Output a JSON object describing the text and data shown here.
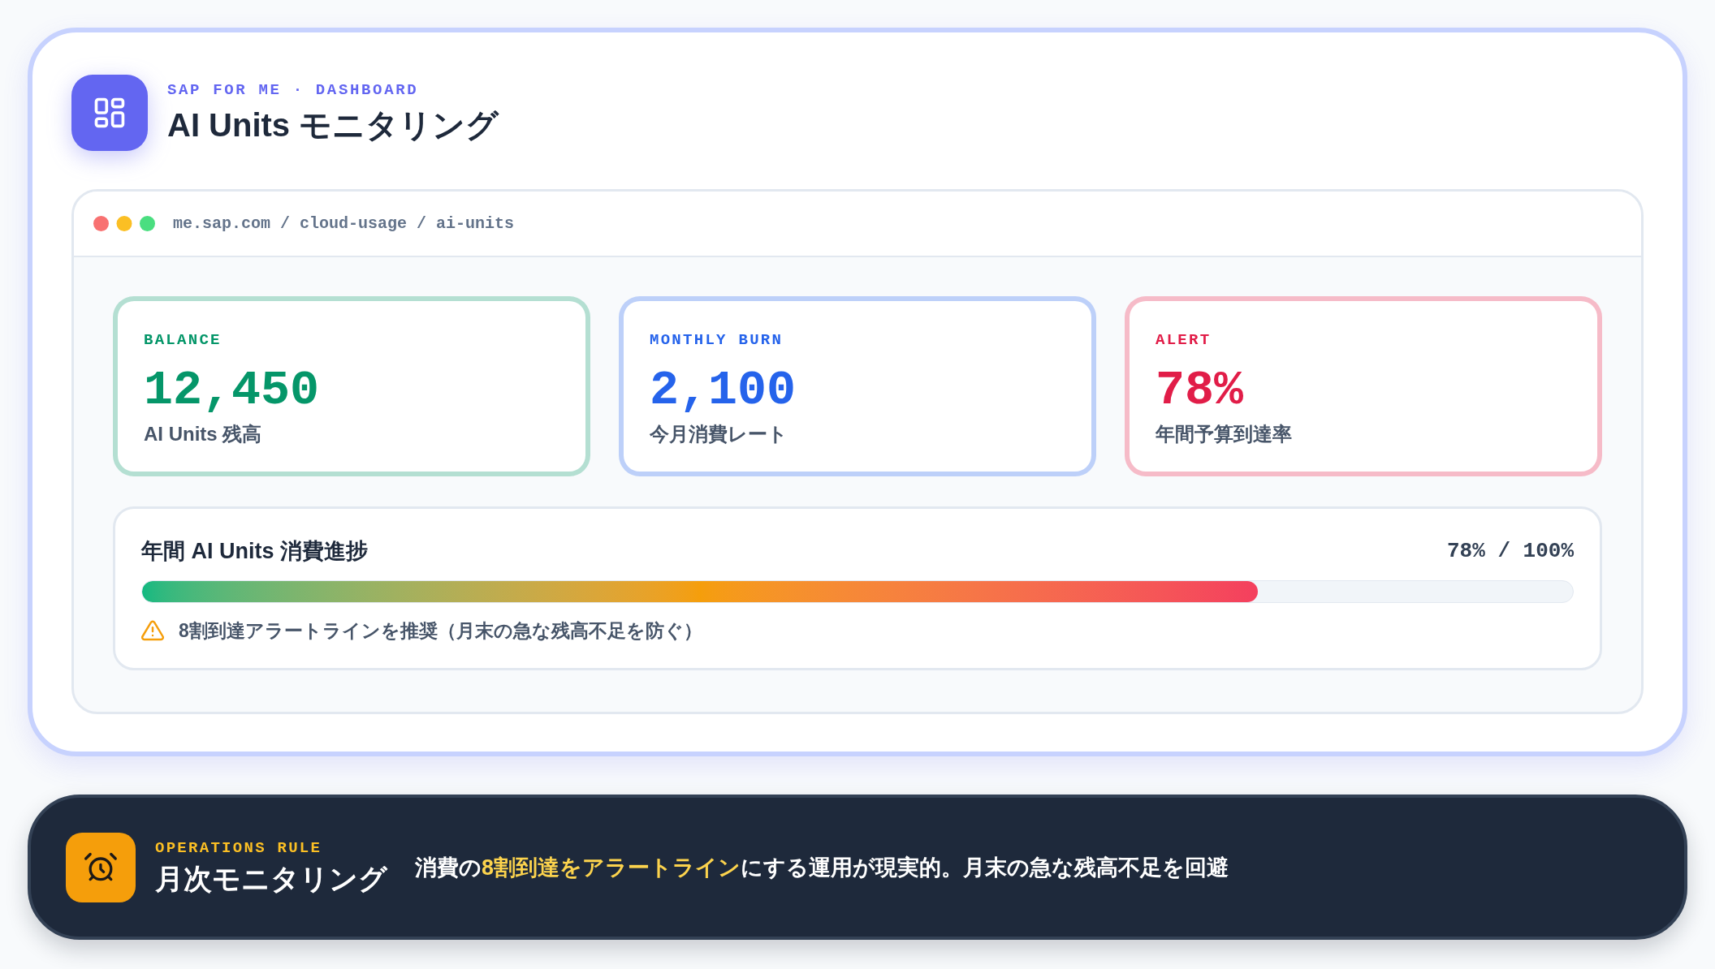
{
  "header": {
    "eyebrow": "SAP FOR ME · DASHBOARD",
    "title": "AI Units モニタリング"
  },
  "browser": {
    "url": "me.sap.com / cloud-usage / ai-units"
  },
  "stats": [
    {
      "label": "BALANCE",
      "value": "12,450",
      "caption": "AI Units 残高",
      "color": "#059669"
    },
    {
      "label": "MONTHLY BURN",
      "value": "2,100",
      "caption": "今月消費レート",
      "color": "#2563eb"
    },
    {
      "label": "ALERT",
      "value": "78%",
      "caption": "年間予算到達率",
      "color": "#e11d48"
    }
  ],
  "progress": {
    "title": "年間 AI Units 消費進捗",
    "reading": "78% / 100%",
    "level": 0.78,
    "note": "8割到達アラートラインを推奨（月末の急な残高不足を防ぐ）"
  },
  "rule": {
    "eyebrow": "OPERATIONS RULE",
    "title": "月次モニタリング",
    "message": [
      {
        "text": "消費の",
        "highlight": false
      },
      {
        "text": "8割到達をアラートライン",
        "highlight": true
      },
      {
        "text": "にする運用が現実的。月末の急な残高不足を回避",
        "highlight": false
      }
    ]
  }
}
